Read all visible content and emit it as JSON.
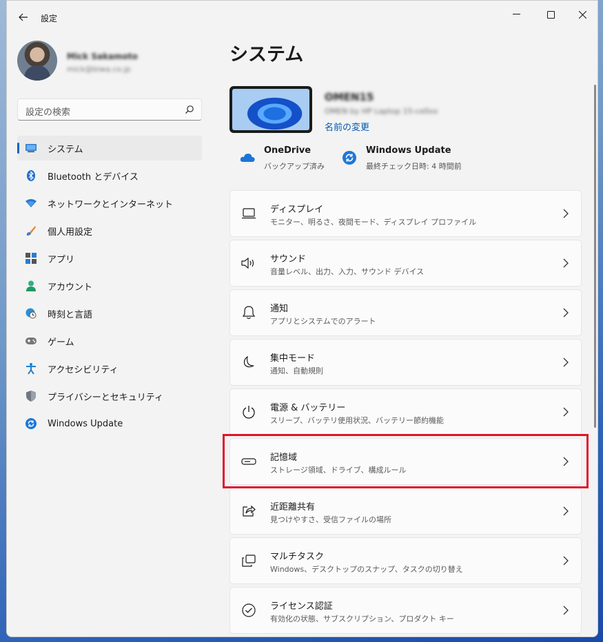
{
  "window": {
    "title": "設定",
    "controls": {
      "minimize": "minimize-icon",
      "maximize": "maximize-icon",
      "close": "close-icon"
    }
  },
  "profile": {
    "name": "Mick Sakamoto",
    "email": "mick@biwa.co.jp"
  },
  "search": {
    "placeholder": "設定の検索"
  },
  "sidebar": {
    "items": [
      {
        "label": "システム",
        "icon": "monitor-icon",
        "active": true
      },
      {
        "label": "Bluetooth とデバイス",
        "icon": "bluetooth-icon"
      },
      {
        "label": "ネットワークとインターネット",
        "icon": "wifi-icon"
      },
      {
        "label": "個人用設定",
        "icon": "brush-icon"
      },
      {
        "label": "アプリ",
        "icon": "apps-icon"
      },
      {
        "label": "アカウント",
        "icon": "account-icon"
      },
      {
        "label": "時刻と言語",
        "icon": "globe-clock-icon"
      },
      {
        "label": "ゲーム",
        "icon": "gamepad-icon"
      },
      {
        "label": "アクセシビリティ",
        "icon": "accessibility-icon"
      },
      {
        "label": "プライバシーとセキュリティ",
        "icon": "shield-icon"
      },
      {
        "label": "Windows Update",
        "icon": "update-icon"
      }
    ]
  },
  "main": {
    "title": "システム",
    "device": {
      "name": "OMEN15",
      "model": "OMEN by HP Laptop 15-ce0xx",
      "rename_label": "名前の変更"
    },
    "status": {
      "onedrive": {
        "title": "OneDrive",
        "sub": "バックアップ済み"
      },
      "update": {
        "title": "Windows Update",
        "sub": "最終チェック日時: 4 時間前"
      }
    },
    "settings": [
      {
        "title": "ディスプレイ",
        "sub": "モニター、明るさ、夜間モード、ディスプレイ プロファイル",
        "icon": "display-icon"
      },
      {
        "title": "サウンド",
        "sub": "音量レベル、出力、入力、サウンド デバイス",
        "icon": "speaker-icon"
      },
      {
        "title": "通知",
        "sub": "アプリとシステムでのアラート",
        "icon": "bell-icon"
      },
      {
        "title": "集中モード",
        "sub": "通知、自動規則",
        "icon": "moon-icon"
      },
      {
        "title": "電源 & バッテリー",
        "sub": "スリープ、バッテリ使用状況、バッテリー節約機能",
        "icon": "power-icon"
      },
      {
        "title": "記憶域",
        "sub": "ストレージ領域、ドライブ、構成ルール",
        "icon": "storage-icon"
      },
      {
        "title": "近距離共有",
        "sub": "見つけやすさ、受信ファイルの場所",
        "icon": "share-icon"
      },
      {
        "title": "マルチタスク",
        "sub": "Windows、デスクトップのスナップ、タスクの切り替え",
        "icon": "multitask-icon"
      },
      {
        "title": "ライセンス認証",
        "sub": "有効化の状態、サブスクリプション、プロダクト キー",
        "icon": "check-circle-icon"
      }
    ]
  },
  "colors": {
    "accent": "#0067c0",
    "highlight": "#e0142a",
    "background": "#f3f3f3"
  }
}
